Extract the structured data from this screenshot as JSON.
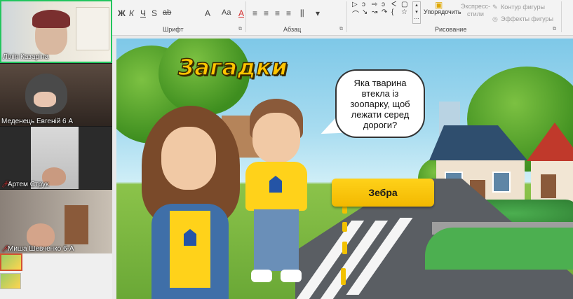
{
  "participants": [
    {
      "name": "Лілія Казаріна",
      "muted": false
    },
    {
      "name": "Меденець Евгеній 6 А",
      "muted": false
    },
    {
      "name": "Артем Струк",
      "muted": true
    },
    {
      "name": "Миша Шевченко 6-А",
      "muted": true
    }
  ],
  "ribbon": {
    "font_group": "Шрифт",
    "paragraph_group": "Абзац",
    "drawing_group": "Рисование",
    "format_buttons": [
      "Ж",
      "К",
      "Ч",
      "S",
      "ab",
      "A",
      "Aa",
      "A"
    ],
    "arrange_label": "Упорядочить",
    "quick_styles_label": "Экспресс-стили",
    "shape_outline_label": "Контур фигуры",
    "shape_effects_label": "Эффекты фигуры",
    "shape_symbols": [
      "▷",
      "ↄ",
      "⇨",
      "ↄ",
      "ᐸ",
      "▢",
      "⌒",
      "↘",
      "↝",
      "↷",
      "{",
      "☆"
    ]
  },
  "slide": {
    "title": "Загадки",
    "riddle": "Яка тварина втекла із зоопарку, щоб лежати серед дороги?",
    "answer": "Зебра"
  },
  "colors": {
    "active_speaker_border": "#22c55e",
    "title_yellow": "#ffc400",
    "answer_button": "#ffd21a",
    "selected_thumb_border": "#d35230"
  }
}
